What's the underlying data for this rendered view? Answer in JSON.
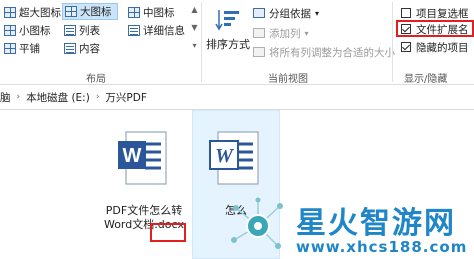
{
  "ribbon": {
    "layout": {
      "group_label": "布局",
      "items": [
        {
          "label": "超大图标",
          "selected": false
        },
        {
          "label": "大图标",
          "selected": true
        },
        {
          "label": "中图标",
          "selected": false
        },
        {
          "label": "小图标",
          "selected": false
        },
        {
          "label": "列表",
          "selected": false
        },
        {
          "label": "详细信息",
          "selected": false
        },
        {
          "label": "平铺",
          "selected": false
        },
        {
          "label": "内容",
          "selected": false
        }
      ]
    },
    "current_view": {
      "group_label": "当前视图",
      "sort_label": "排序方式",
      "group_by_label": "分组依据",
      "add_columns_label": "添加列",
      "size_columns_label": "将所有列调整为合适的大小"
    },
    "show_hide": {
      "group_label": "显示/隐藏",
      "item_checkboxes": {
        "label": "项目复选框",
        "checked": false
      },
      "file_extensions": {
        "label": "文件扩展名",
        "checked": true
      },
      "hidden_items": {
        "label": "隐藏的项目",
        "checked": true
      }
    }
  },
  "address": {
    "crumbs": [
      "脑",
      "本地磁盘 (E:)",
      "万兴PDF"
    ]
  },
  "files": [
    {
      "name_line1": "PDF文件怎么转",
      "name_line2": "Word文档.docx",
      "icon": "word-docx-icon"
    },
    {
      "name_line1": "怎么",
      "name_line2": "",
      "icon": "word-doc-icon"
    }
  ],
  "watermark": {
    "title": "星火智游网",
    "url": "www.xhcs188.com"
  },
  "colors": {
    "accent": "#1f86c8",
    "highlight_red": "#e02020",
    "selection": "#cce4f7",
    "word_blue": "#2b579a"
  }
}
